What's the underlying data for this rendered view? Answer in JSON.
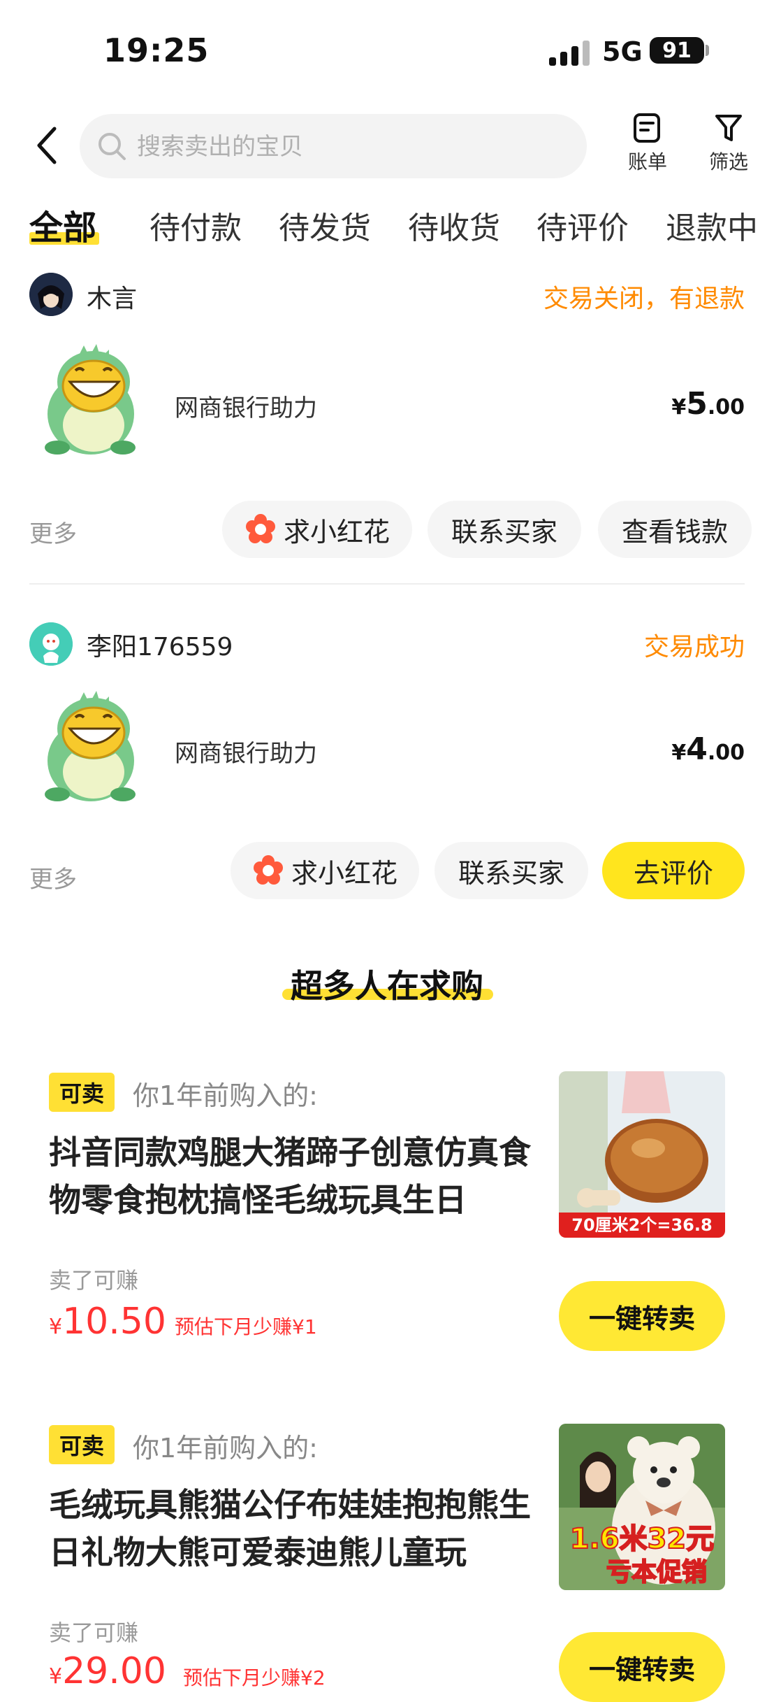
{
  "status_bar": {
    "time": "19:25",
    "network": "5G",
    "battery": "91"
  },
  "header": {
    "search_placeholder": "搜索卖出的宝贝",
    "bill_label": "账单",
    "filter_label": "筛选"
  },
  "tabs": [
    {
      "label": "全部",
      "active": true
    },
    {
      "label": "待付款"
    },
    {
      "label": "待发货"
    },
    {
      "label": "待收货"
    },
    {
      "label": "待评价"
    },
    {
      "label": "退款中"
    }
  ],
  "orders": [
    {
      "buyer": "木言",
      "status": "交易关闭，有退款",
      "product": "网商银行助力",
      "currency": "¥",
      "price_int": "5",
      "price_dec": ".00",
      "more": "更多",
      "actions": [
        "求小红花",
        "联系买家",
        "查看钱款"
      ]
    },
    {
      "buyer": "李阳176559",
      "status": "交易成功",
      "product": "网商银行助力",
      "currency": "¥",
      "price_int": "4",
      "price_dec": ".00",
      "more": "更多",
      "actions": [
        "求小红花",
        "联系买家",
        "去评价"
      ]
    }
  ],
  "promo": {
    "title": "超多人在求购",
    "items": [
      {
        "tag": "可卖",
        "bought": "你1年前购入的:",
        "title": "抖音同款鸡腿大猪蹄子创意仿真食物零食抱枕搞怪毛绒玩具生日",
        "earn_label": "卖了可赚",
        "currency": "¥",
        "earn": "10.50",
        "estimate": "预估下月少赚¥1",
        "image_caption": "70厘米2个=36.8",
        "button": "一键转卖"
      },
      {
        "tag": "可卖",
        "bought": "你1年前购入的:",
        "title": "毛绒玩具熊猫公仔布娃娃抱抱熊生日礼物大熊可爱泰迪熊儿童玩",
        "earn_label": "卖了可赚",
        "currency": "¥",
        "earn": "29.00",
        "estimate": "预估下月少赚¥2",
        "image_caption": "1.6米32元",
        "image_caption2": "亏本促销",
        "button": "一键转卖"
      }
    ]
  },
  "colors": {
    "accent_yellow": "#ffe034",
    "status_orange": "#ff8a00",
    "price_red": "#ff3333"
  }
}
